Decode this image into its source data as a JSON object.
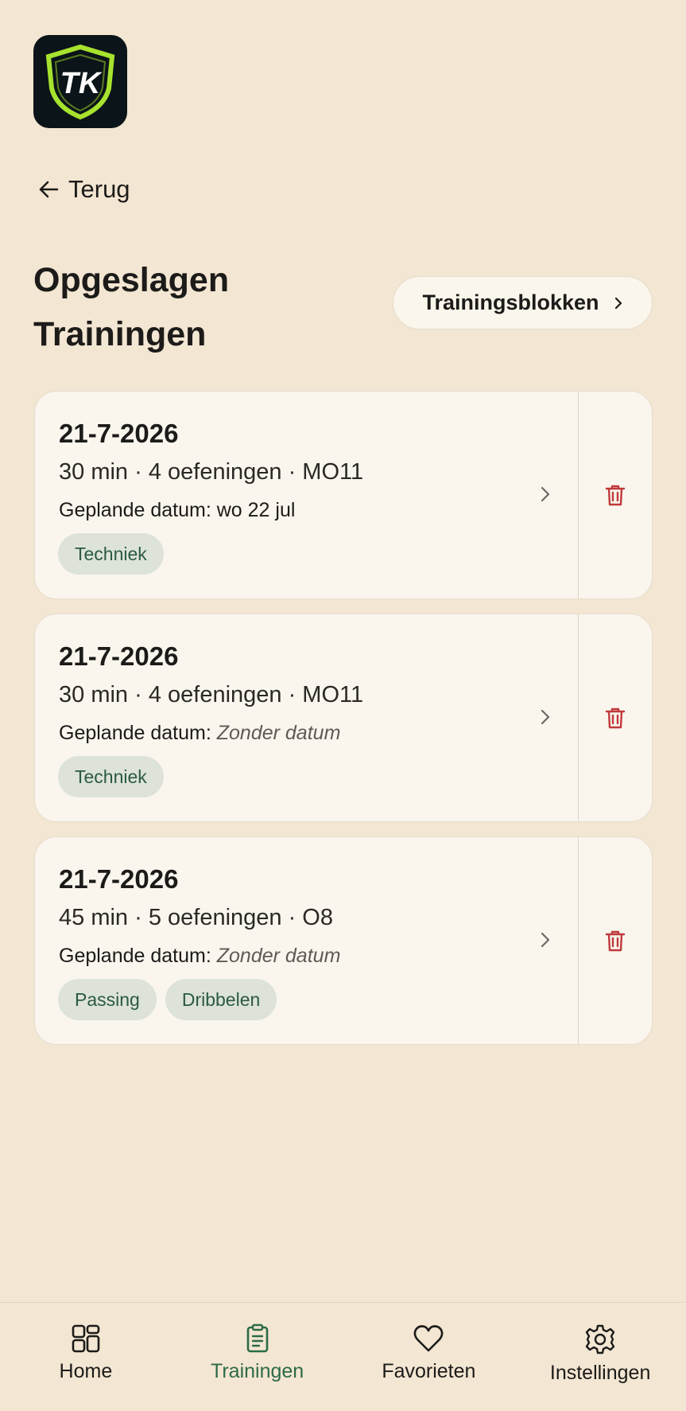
{
  "app": {
    "logo_text": "TK",
    "accent_color": "#a6e22e"
  },
  "header": {
    "back_label": "Terug",
    "title_line1": "Opgeslagen",
    "title_line2": "Trainingen",
    "blocks_button_label": "Trainingsblokken"
  },
  "trainings": [
    {
      "date": "21-7-2026",
      "meta": "30 min · 4 oefeningen · MO11",
      "planned_label": "Geplande datum:",
      "planned_value": "wo 22 jul",
      "planned_italic": false,
      "tags": [
        "Techniek"
      ]
    },
    {
      "date": "21-7-2026",
      "meta": "30 min · 4 oefeningen · MO11",
      "planned_label": "Geplande datum:",
      "planned_value": "Zonder datum",
      "planned_italic": true,
      "tags": [
        "Techniek"
      ]
    },
    {
      "date": "21-7-2026",
      "meta": "45 min · 5 oefeningen · O8",
      "planned_label": "Geplande datum:",
      "planned_value": "Zonder datum",
      "planned_italic": true,
      "tags": [
        "Passing",
        "Dribbelen"
      ]
    }
  ],
  "bottom_nav": {
    "items": [
      {
        "label": "Home",
        "icon": "dashboard-icon",
        "active": false
      },
      {
        "label": "Trainingen",
        "icon": "clipboard-icon",
        "active": true
      },
      {
        "label": "Favorieten",
        "icon": "heart-icon",
        "active": false
      },
      {
        "label": "Instellingen",
        "icon": "gear-icon",
        "active": false
      }
    ]
  },
  "colors": {
    "background": "#f3e6d2",
    "card": "#faf6ee",
    "tag_bg": "#dde3d9",
    "tag_text": "#2b5a3f",
    "delete": "#c0393b",
    "nav_active": "#2c6a47"
  }
}
